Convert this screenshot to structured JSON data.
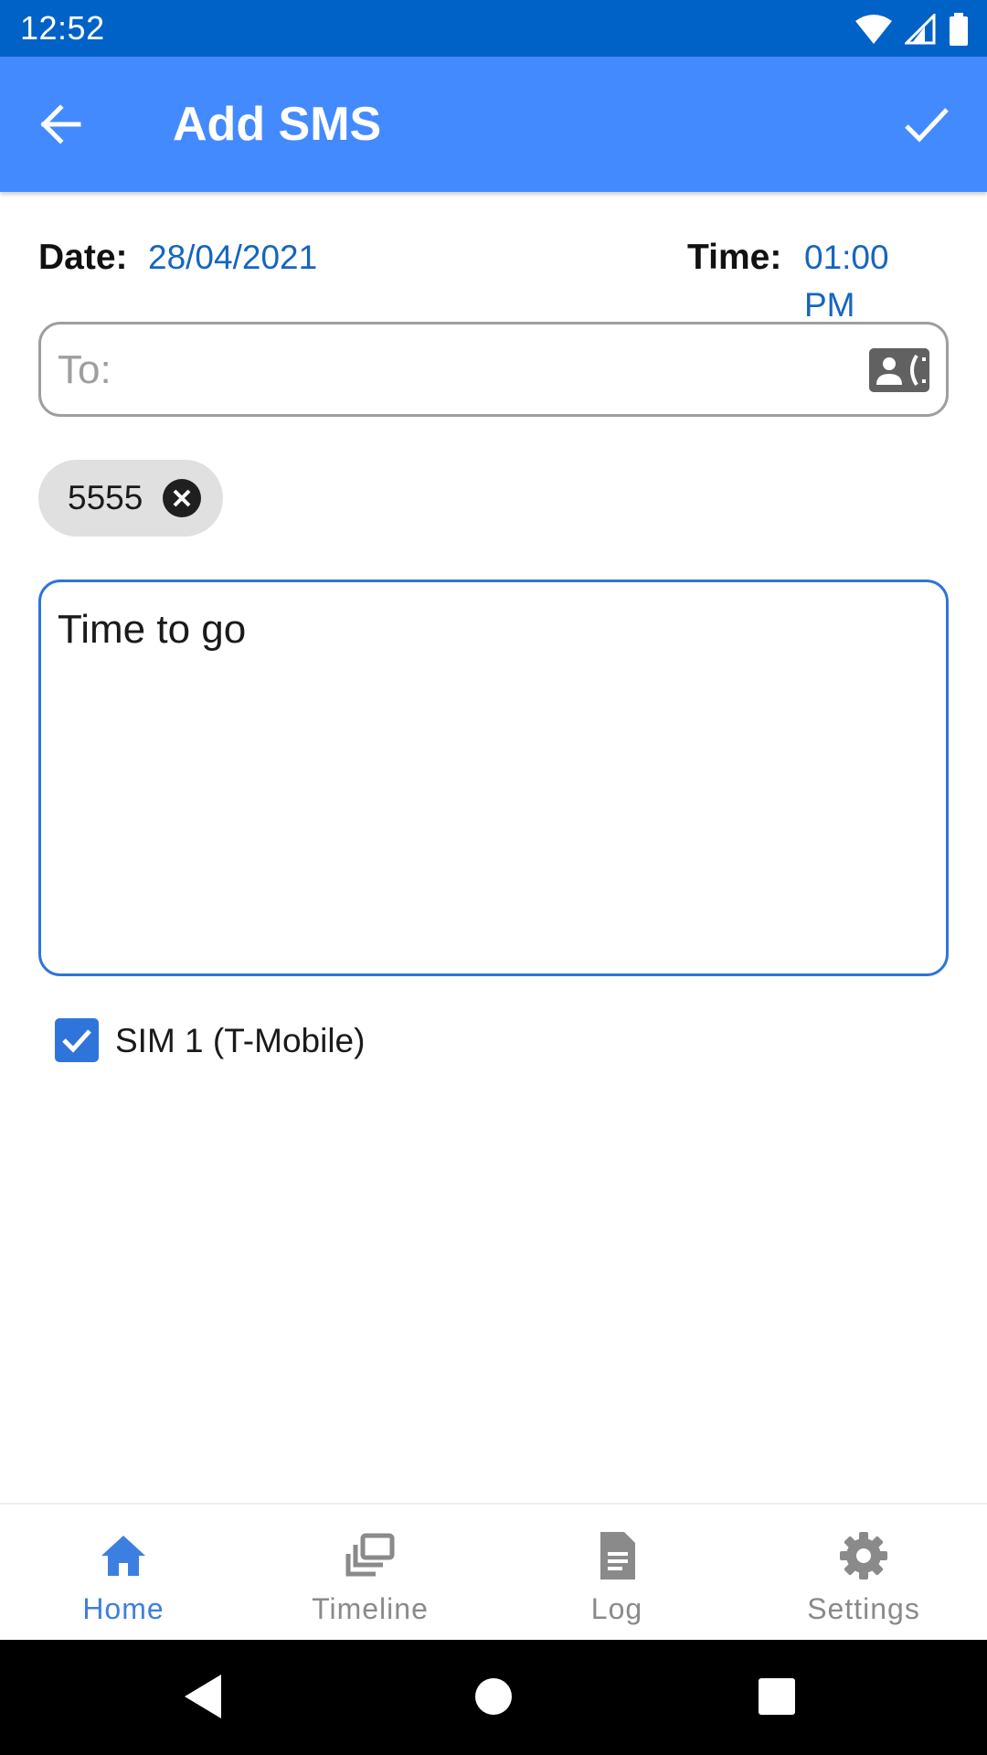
{
  "status_bar": {
    "time": "12:52",
    "icons": [
      "wifi-icon",
      "cell-signal-icon",
      "battery-icon"
    ]
  },
  "app_bar": {
    "title": "Add SMS",
    "back_icon": "arrow-back-icon",
    "save_icon": "check-icon"
  },
  "form": {
    "date_label": "Date:",
    "date_value": "28/04/2021",
    "time_label": "Time:",
    "time_value": "01:00 PM",
    "to_placeholder": "To:",
    "contact_icon": "contact-phone-icon",
    "recipients": [
      {
        "label": "5555"
      }
    ],
    "message": "Time to go",
    "sim_option": {
      "label": "SIM 1 (T-Mobile)",
      "checked": true
    }
  },
  "bottom_nav": {
    "items": [
      {
        "label": "Home",
        "icon": "home-icon",
        "active": true
      },
      {
        "label": "Timeline",
        "icon": "timeline-icon",
        "active": false
      },
      {
        "label": "Log",
        "icon": "document-icon",
        "active": false
      },
      {
        "label": "Settings",
        "icon": "gear-icon",
        "active": false
      }
    ]
  },
  "colors": {
    "status_bar": "#0062c7",
    "app_bar": "#448aff",
    "accent": "#2f74db",
    "link_blue": "#1565c0",
    "nav_active": "#3d7fe0",
    "nav_inactive": "#8a8a8a"
  }
}
